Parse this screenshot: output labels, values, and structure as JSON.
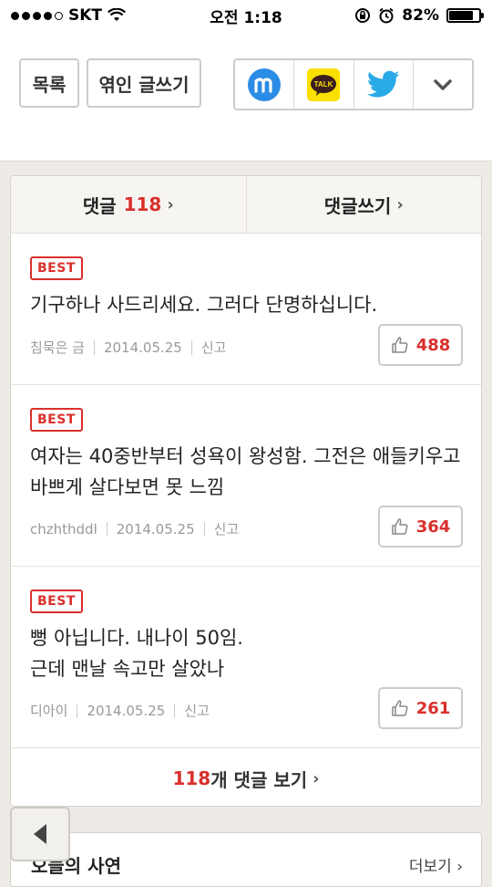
{
  "status": {
    "carrier": "SKT",
    "time": "오전 1:18",
    "battery": "82%",
    "battery_level": 0.82
  },
  "toolbar": {
    "list_label": "목록",
    "write_label": "엮인 글쓰기",
    "share_icons": [
      "mypeople-icon",
      "kakaotalk-icon",
      "twitter-icon",
      "chevron-down-icon"
    ],
    "kakao_text": "TALK"
  },
  "comments_header": {
    "tab_comments": "댓글",
    "count": "118",
    "tab_write": "댓글쓰기",
    "chevron": "›"
  },
  "comments": [
    {
      "badge": "BEST",
      "text": "기구하나 사드리세요. 그러다 단명하십니다.",
      "author": "침묵은 금",
      "date": "2014.05.25",
      "report": "신고",
      "likes": "488"
    },
    {
      "badge": "BEST",
      "text": "여자는 40중반부터 성욕이 왕성함. 그전은 애들키우고 바쁘게 살다보면 못 느낌",
      "author": "chzhthddl",
      "date": "2014.05.25",
      "report": "신고",
      "likes": "364"
    },
    {
      "badge": "BEST",
      "text": "뻥 아닙니다. 내나이 50임.\n근데 맨날 속고만 살았나",
      "author": "디아이",
      "date": "2014.05.25",
      "report": "신고",
      "likes": "261"
    }
  ],
  "more_comments": {
    "count": "118",
    "label": "개 댓글 보기",
    "chevron": "›"
  },
  "today_story": {
    "title": "오늘의 사연",
    "more": "더보기",
    "chevron": "›"
  },
  "colors": {
    "accent": "#d9302c",
    "background": "#eeebe7"
  }
}
